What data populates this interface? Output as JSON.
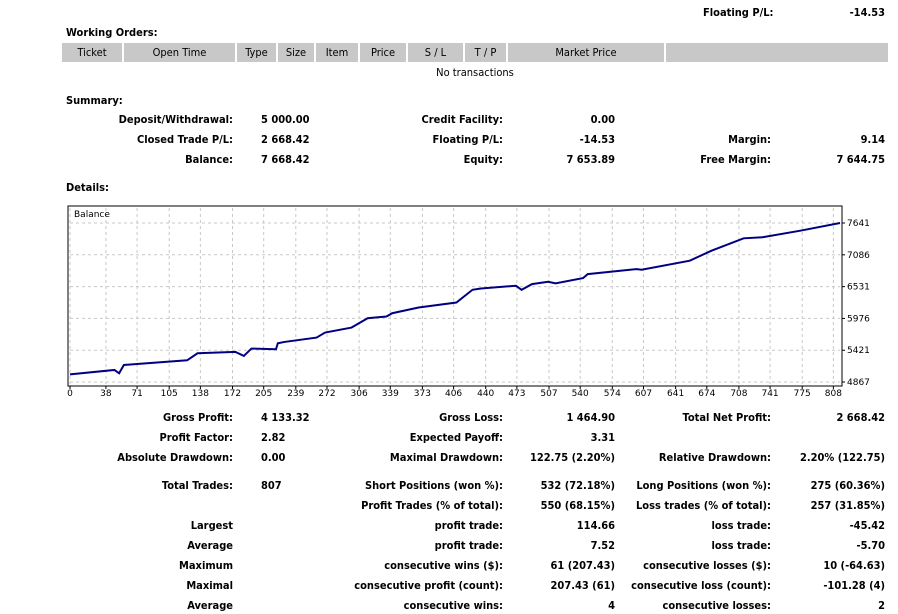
{
  "top": {
    "floating_label": "Floating P/L:",
    "floating_value": "-14.53"
  },
  "working_orders": {
    "title": "Working Orders:",
    "columns": [
      "Ticket",
      "Open Time",
      "Type",
      "Size",
      "Item",
      "Price",
      "S / L",
      "T / P",
      "Market Price",
      ""
    ],
    "empty_text": "No transactions"
  },
  "summary": {
    "title": "Summary:",
    "rows": [
      [
        "Deposit/Withdrawal:",
        "5 000.00",
        "Credit Facility:",
        "0.00",
        "",
        ""
      ],
      [
        "Closed Trade P/L:",
        "2 668.42",
        "Floating P/L:",
        "-14.53",
        "Margin:",
        "9.14"
      ],
      [
        "Balance:",
        "7 668.42",
        "Equity:",
        "7 653.89",
        "Free Margin:",
        "7 644.75"
      ]
    ]
  },
  "details": {
    "title": "Details:",
    "rows": [
      [
        "Gross Profit:",
        "4 133.32",
        "Gross Loss:",
        "1 464.90",
        "Total Net Profit:",
        "2 668.42"
      ],
      [
        "Profit Factor:",
        "2.82",
        "Expected Payoff:",
        "3.31",
        "",
        ""
      ],
      [
        "Absolute Drawdown:",
        "0.00",
        "Maximal Drawdown:",
        "122.75 (2.20%)",
        "Relative Drawdown:",
        "2.20% (122.75)"
      ],
      [
        "Total Trades:",
        "807",
        "Short Positions (won %):",
        "532 (72.18%)",
        "Long Positions (won %):",
        "275 (60.36%)"
      ],
      [
        "",
        "",
        "Profit Trades (% of total):",
        "550 (68.15%)",
        "Loss trades (% of total):",
        "257 (31.85%)"
      ],
      [
        "Largest",
        "",
        "profit trade:",
        "114.66",
        "loss trade:",
        "-45.42"
      ],
      [
        "Average",
        "",
        "profit trade:",
        "7.52",
        "loss trade:",
        "-5.70"
      ],
      [
        "Maximum",
        "",
        "consecutive wins ($):",
        "61 (207.43)",
        "consecutive losses ($):",
        "10 (-64.63)"
      ],
      [
        "Maximal",
        "",
        "consecutive profit (count):",
        "207.43 (61)",
        "consecutive loss (count):",
        "-101.28 (4)"
      ],
      [
        "Average",
        "",
        "consecutive wins:",
        "4",
        "consecutive losses:",
        "2"
      ]
    ]
  },
  "chart_data": {
    "type": "line",
    "legend": "Balance",
    "line_color": "#000080",
    "grid": true,
    "xlim": [
      0,
      815
    ],
    "ylim": [
      4867,
      7641
    ],
    "x_ticks": [
      0,
      38,
      71,
      105,
      138,
      172,
      205,
      239,
      272,
      306,
      339,
      373,
      406,
      440,
      473,
      507,
      540,
      574,
      607,
      641,
      674,
      708,
      741,
      775,
      808
    ],
    "y_ticks": [
      4867,
      5421,
      5976,
      6531,
      7086,
      7641
    ],
    "series": [
      {
        "x": [
          0,
          47,
          52,
          57,
          124,
          135,
          175,
          184,
          192,
          218,
          220,
          227,
          261,
          270,
          298,
          315,
          335,
          341,
          369,
          409,
          426,
          435,
          472,
          478,
          489,
          506,
          514,
          543,
          548,
          600,
          605,
          656,
          679,
          713,
          733,
          773,
          815
        ],
        "y": [
          5000,
          5077,
          5019,
          5164,
          5246,
          5368,
          5392,
          5322,
          5450,
          5438,
          5543,
          5566,
          5642,
          5730,
          5817,
          5980,
          6010,
          6067,
          6166,
          6254,
          6476,
          6499,
          6546,
          6476,
          6575,
          6616,
          6587,
          6680,
          6750,
          6837,
          6826,
          6983,
          7158,
          7374,
          7392,
          7507,
          7641
        ]
      }
    ]
  }
}
